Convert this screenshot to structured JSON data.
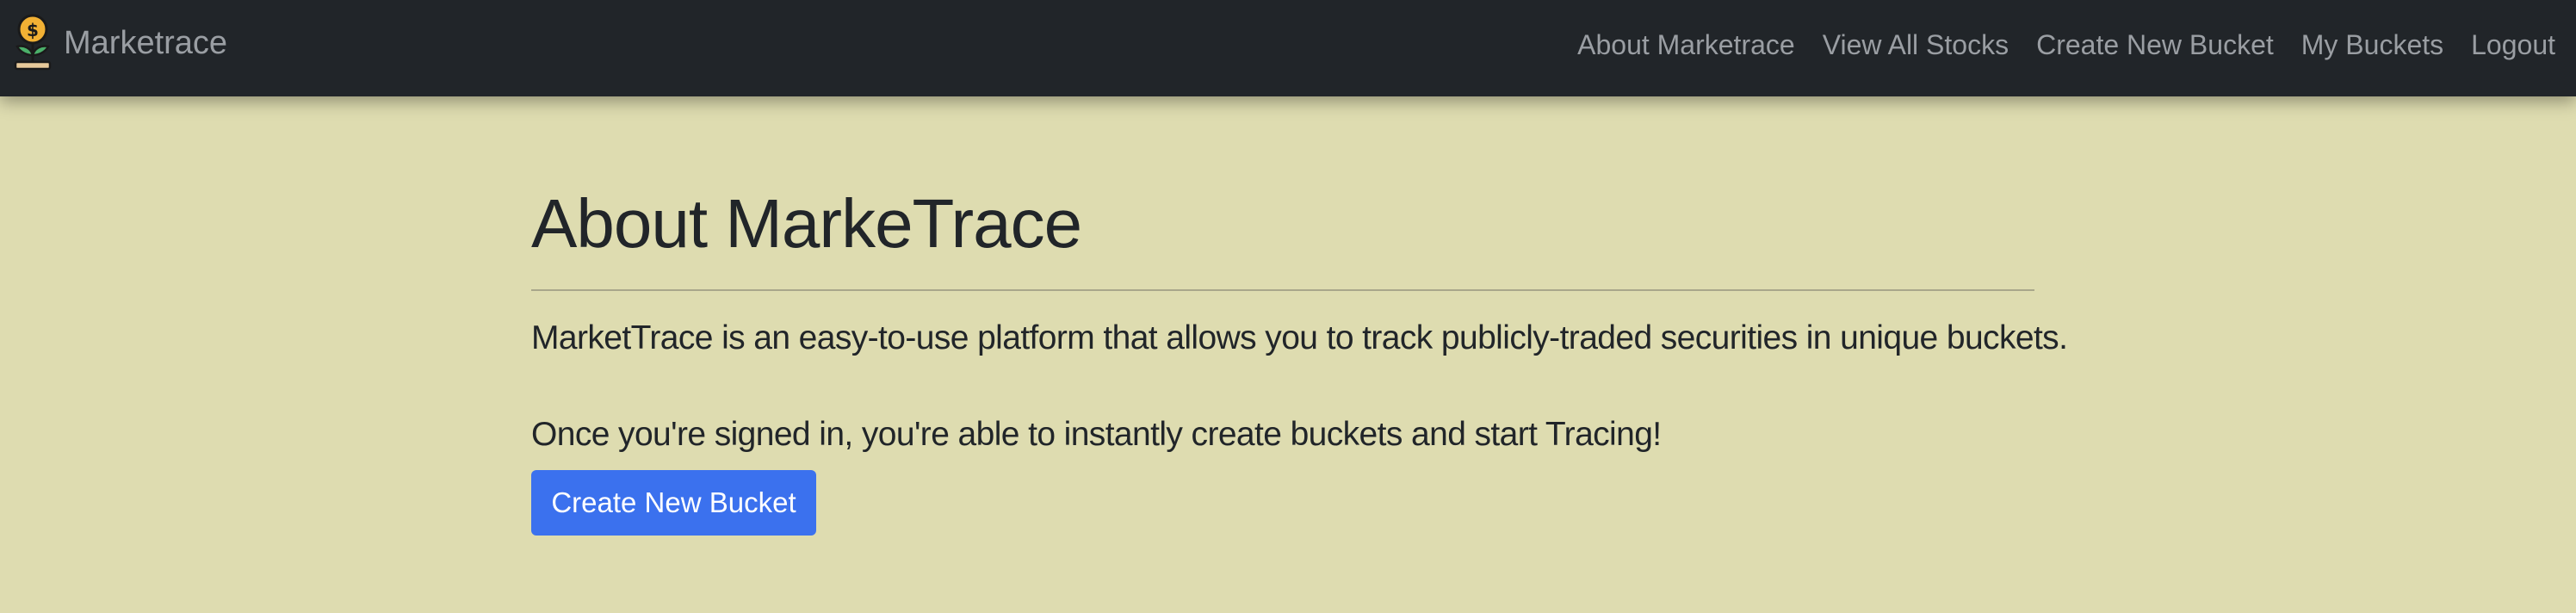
{
  "navbar": {
    "brand_name": "Marketrace",
    "brand_icon": "money-plant-icon",
    "links": [
      {
        "label": "About Marketrace"
      },
      {
        "label": "View All Stocks"
      },
      {
        "label": "Create New Bucket"
      },
      {
        "label": "My Buckets"
      },
      {
        "label": "Logout"
      }
    ]
  },
  "main": {
    "title": "About MarkeTrace",
    "paragraph_1": "MarketTrace is an easy-to-use platform that allows you to track publicly-traded securities in unique buckets.",
    "paragraph_2": "Once you're signed in, you're able to instantly create buckets and start Tracing!",
    "cta_label": "Create New Bucket"
  },
  "colors": {
    "navbar_bg": "#212529",
    "page_bg": "#dedcb0",
    "nav_text": "#9a9ea3",
    "primary_button": "#3b71ee",
    "heading_text": "#212529"
  }
}
